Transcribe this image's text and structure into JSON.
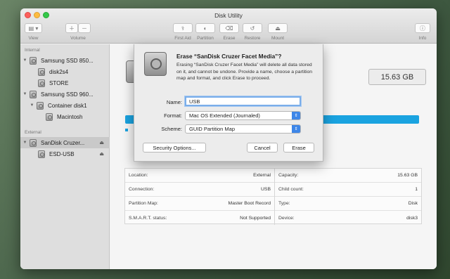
{
  "window": {
    "title": "Disk Utility"
  },
  "toolbar": {
    "view_label": "View",
    "volume_label": "Volume",
    "first_aid_label": "First Aid",
    "partition_label": "Partition",
    "erase_label": "Erase",
    "restore_label": "Restore",
    "mount_label": "Mount",
    "info_label": "Info"
  },
  "sidebar": {
    "internal_header": "Internal",
    "external_header": "External",
    "items": [
      {
        "label": "Samsung SSD 850..."
      },
      {
        "label": "disk2s4"
      },
      {
        "label": "STORE"
      },
      {
        "label": "Samsung SSD 960..."
      },
      {
        "label": "Container disk1"
      },
      {
        "label": "Macintosh"
      },
      {
        "label": "SanDisk Cruzer..."
      },
      {
        "label": "ESD-USB"
      }
    ]
  },
  "main": {
    "capacity_display": "15.63 GB",
    "info": {
      "location_label": "Location:",
      "location_value": "External",
      "connection_label": "Connection:",
      "connection_value": "USB",
      "partition_map_label": "Partition Map:",
      "partition_map_value": "Master Boot Record",
      "smart_label": "S.M.A.R.T. status:",
      "smart_value": "Not Supported",
      "capacity_label": "Capacity:",
      "capacity_value": "15.63 GB",
      "child_count_label": "Child count:",
      "child_count_value": "1",
      "type_label": "Type:",
      "type_value": "Disk",
      "device_label": "Device:",
      "device_value": "disk3"
    }
  },
  "dialog": {
    "title": "Erase “SanDisk Cruzer Facet Media”?",
    "message": "Erasing “SanDisk Cruzer Facet Media” will delete all data stored on it, and cannot be undone. Provide a name, choose a partition map and format, and click Erase to proceed.",
    "name_label": "Name:",
    "name_value": "USB",
    "format_label": "Format:",
    "format_value": "Mac OS Extended (Journaled)",
    "scheme_label": "Scheme:",
    "scheme_value": "GUID Partition Map",
    "security_button": "Security Options...",
    "cancel_button": "Cancel",
    "erase_button": "Erase"
  },
  "colors": {
    "accent": "#3d86e8",
    "usage_bar": "#1aa3e0"
  }
}
